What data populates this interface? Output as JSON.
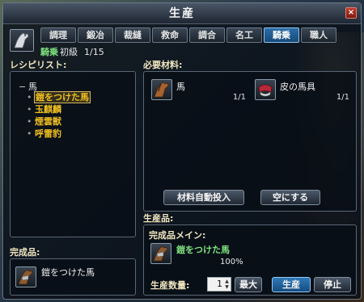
{
  "window": {
    "title": "生産",
    "close_label": "×"
  },
  "tabs": [
    {
      "label": "調理",
      "active": false
    },
    {
      "label": "鍛冶",
      "active": false
    },
    {
      "label": "裁縫",
      "active": false
    },
    {
      "label": "救命",
      "active": false
    },
    {
      "label": "調合",
      "active": false
    },
    {
      "label": "名工",
      "active": false
    },
    {
      "label": "騎乗",
      "active": true
    },
    {
      "label": "職人",
      "active": false
    }
  ],
  "skill": {
    "name": "騎乗",
    "rank": "初級",
    "progress": "1/15"
  },
  "recipe_list": {
    "label": "レシピリスト:",
    "category_toggle": "−",
    "category": "馬",
    "items": [
      {
        "name": "鎧をつけた馬",
        "selected": true
      },
      {
        "name": "玉麒麟",
        "selected": false
      },
      {
        "name": "煙雲獣",
        "selected": false
      },
      {
        "name": "呼雷豹",
        "selected": false
      }
    ]
  },
  "materials": {
    "label": "必要材料:",
    "items": [
      {
        "name": "馬",
        "qty": "1/1",
        "icon": "horse-icon"
      },
      {
        "name": "皮の馬具",
        "qty": "1/1",
        "icon": "saddle-icon"
      }
    ],
    "auto_insert_label": "材料自動投入",
    "clear_label": "空にする"
  },
  "product": {
    "label": "生産品:",
    "main_label": "完成品メイン:",
    "main_name": "鎧をつけた馬",
    "main_rate": "100%",
    "qty_label": "生産数量:",
    "qty_value": "1",
    "max_label": "最大",
    "produce_label": "生産",
    "stop_label": "停止"
  },
  "result": {
    "label": "完成品:",
    "name": "鎧をつけた馬"
  },
  "colors": {
    "accent_blue": "#2f78b8",
    "skill_green": "#7ee07e",
    "recipe_gold": "#f0c020",
    "label_cream": "#f0e6c0"
  }
}
